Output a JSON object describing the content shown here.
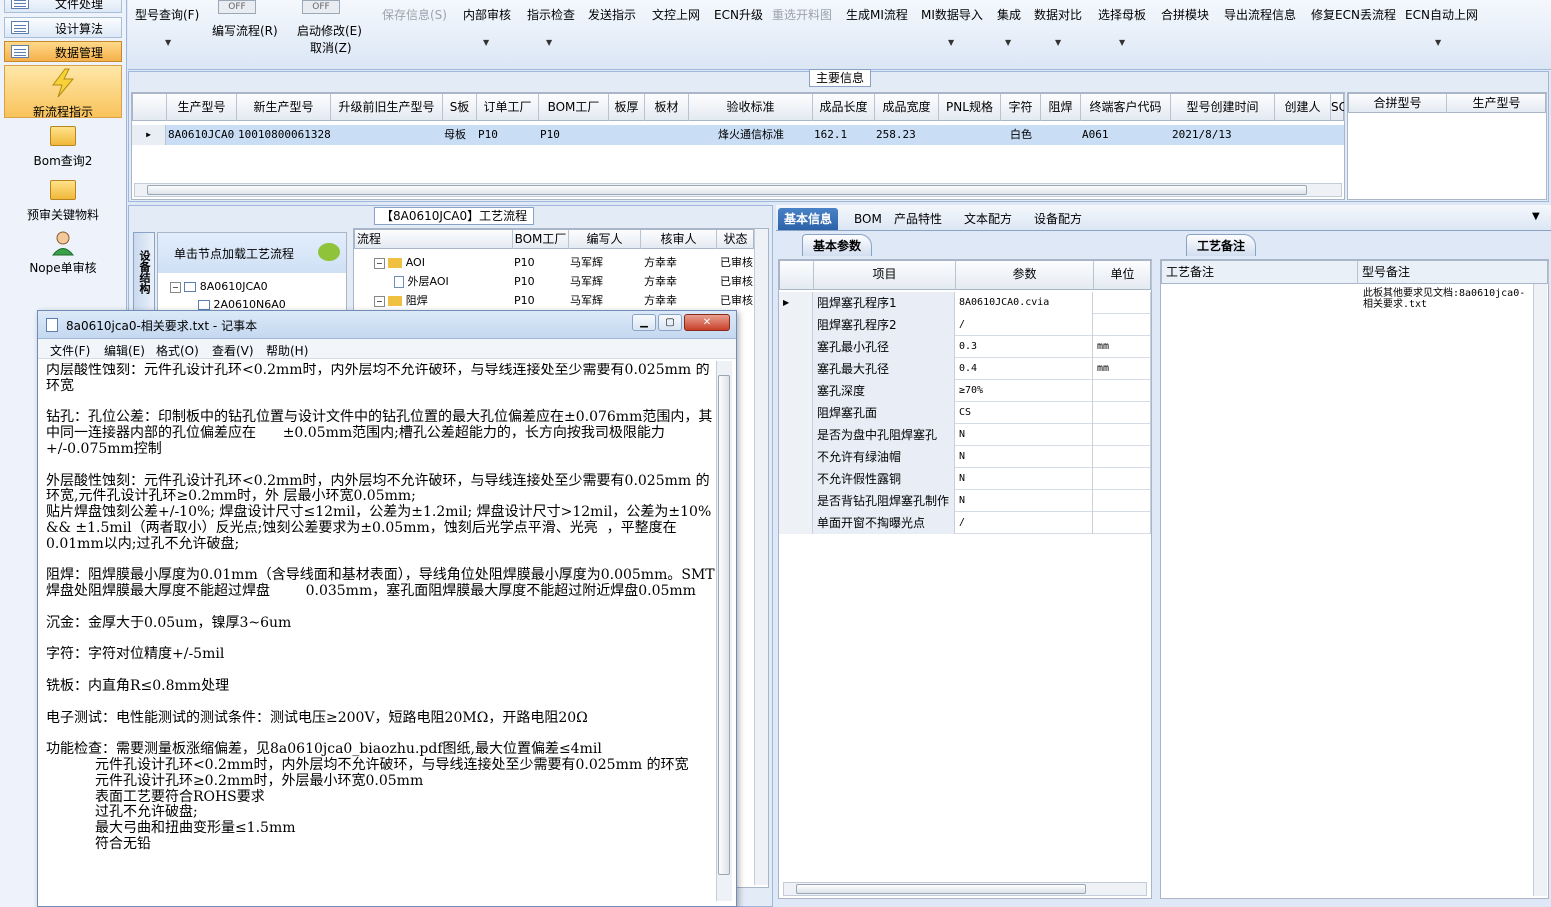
{
  "leftnav": {
    "items": [
      {
        "label": "文件处理"
      },
      {
        "label": "设计算法"
      },
      {
        "label": "数据管理"
      }
    ],
    "big": [
      {
        "label": "新流程指示"
      },
      {
        "label": "Bom查询2"
      },
      {
        "label": "预审关键物料"
      },
      {
        "label": "Nope单审核"
      }
    ]
  },
  "toolbar": {
    "toggle1": "OFF",
    "toggle2": "OFF",
    "items": [
      "型号查询(F)",
      "编写流程(R)",
      "启动修改(E)",
      "取消(Z)",
      "保存信息(S)",
      "内部审核",
      "指示检查",
      "发送指示",
      "文控上网",
      "ECN升级",
      "重选开料图",
      "生成MI流程",
      "MI数据导入",
      "集成",
      "数据对比",
      "选择母板",
      "合拼模块",
      "导出流程信息",
      "修复ECN丢流程",
      "ECN自动上网"
    ]
  },
  "main_info": {
    "legend": "主要信息",
    "headers": [
      "生产型号",
      "新生产型号",
      "升级前旧生产型号",
      "S板",
      "订单工厂",
      "BOM工厂",
      "板厚",
      "板材",
      "验收标准",
      "成品长度",
      "成品宽度",
      "PNL规格",
      "字符",
      "阻焊",
      "终端客户代码",
      "型号创建时间",
      "创建人",
      "SO"
    ],
    "row": [
      "8A0610JCA0",
      "10010800061328",
      "",
      "母板",
      "P10",
      "P10",
      "",
      "",
      "烽火通信标准",
      "162.1",
      "258.23",
      "",
      "白色",
      "",
      "A061",
      "2021/8/13",
      "",
      ""
    ],
    "right_headers": [
      "合拼型号",
      "生产型号"
    ]
  },
  "process": {
    "legend": "【8A0610JCA0】工艺流程",
    "side_tab": "设备结构",
    "load_hint": "单击节点加载工艺流程",
    "tree": [
      "8A0610JCA0",
      "2A0610N6A0"
    ],
    "flow_headers": [
      "流程",
      "BOM工厂",
      "编写人",
      "核审人",
      "状态"
    ],
    "flow_rows": [
      [
        "AOI",
        "P10",
        "马军辉",
        "方幸幸",
        "已审核"
      ],
      [
        "外层AOI",
        "P10",
        "马军辉",
        "方幸幸",
        "已审核"
      ],
      [
        "阻焊",
        "P10",
        "马军辉",
        "方幸幸",
        "已审核"
      ]
    ]
  },
  "right": {
    "tabs": [
      "基本信息",
      "BOM",
      "产品特性",
      "文本配方",
      "设备配方"
    ],
    "subtab_params": "基本参数",
    "subtab_notes": "工艺备注",
    "param_headers": [
      "项目",
      "参数",
      "单位"
    ],
    "params": [
      [
        "阻焊塞孔程序1",
        "8A0610JCA0.cvia",
        ""
      ],
      [
        "阻焊塞孔程序2",
        "/",
        ""
      ],
      [
        "塞孔最小孔径",
        "0.3",
        "mm"
      ],
      [
        "塞孔最大孔径",
        "0.4",
        "mm"
      ],
      [
        "塞孔深度",
        "≥70%",
        ""
      ],
      [
        "阻焊塞孔面",
        "CS",
        ""
      ],
      [
        "是否为盘中孔阻焊塞孔",
        "N",
        ""
      ],
      [
        "不允许有绿油帽",
        "N",
        ""
      ],
      [
        "不允许假性露铜",
        "N",
        ""
      ],
      [
        "是否背钻孔阻焊塞孔制作",
        "N",
        ""
      ],
      [
        "单面开窗不掏曝光点",
        "/",
        ""
      ]
    ],
    "notes_headers": [
      "工艺备注",
      "型号备注"
    ],
    "model_note": "此板其他要求见文档:8a0610jca0-相关要求.txt"
  },
  "notepad": {
    "title": "8a0610jca0-相关要求.txt - 记事本",
    "menu": [
      "文件(F)",
      "编辑(E)",
      "格式(O)",
      "查看(V)",
      "帮助(H)"
    ],
    "text": "内层酸性蚀刻：元件孔设计孔环<0.2mm时，内外层均不允许破环，与导线连接处至少需要有0.025mm 的环宽\n\n钻孔：孔位公差：印制板中的钻孔位置与设计文件中的钻孔位置的最大孔位偏差应在±0.076mm范围内，其中同一连接器内部的孔位偏差应在      ±0.05mm范围内;槽孔公差超能力的，长方向按我司极限能力+/-0.075mm控制\n\n外层酸性蚀刻：元件孔设计孔环<0.2mm时，内外层均不允许破环，与导线连接处至少需要有0.025mm 的环宽,元件孔设计孔环≥0.2mm时，外 层最小环宽0.05mm;\n贴片焊盘蚀刻公差+/-10%; 焊盘设计尺寸≤12mil，公差为±1.2mil; 焊盘设计尺寸>12mil，公差为±10% && ±1.5mil（两者取小）反光点;蚀刻公差要求为±0.05mm，蚀刻后光学点平滑、光亮  ，平整度在0.01mm以内;过孔不允许破盘;\n\n阻焊：阻焊膜最小厚度为0.01mm（含导线面和基材表面），导线角位处阻焊膜最小厚度为0.005mm。SMT焊盘处阻焊膜最大厚度不能超过焊盘        0.035mm，塞孔面阻焊膜最大厚度不能超过附近焊盘0.05mm\n\n沉金：金厚大于0.05um，镍厚3~6um\n\n字符：字符对位精度+/-5mil\n\n铣板：内直角R≤0.8mm处理\n\n电子测试：电性能测试的测试条件：测试电压≥200V，短路电阻20MΩ，开路电阻20Ω\n\n功能检查：需要测量板涨缩偏差，见8a0610jca0_biaozhu.pdf图纸,最大位置偏差≤4mil\n           元件孔设计孔环<0.2mm时，内外层均不允许破环，与导线连接处至少需要有0.025mm 的环宽\n           元件孔设计孔环≥0.2mm时，外层最小环宽0.05mm\n           表面工艺要符合ROHS要求\n           过孔不允许破盘;\n           最大弓曲和扭曲变形量≤1.5mm\n           符合无铅"
  }
}
